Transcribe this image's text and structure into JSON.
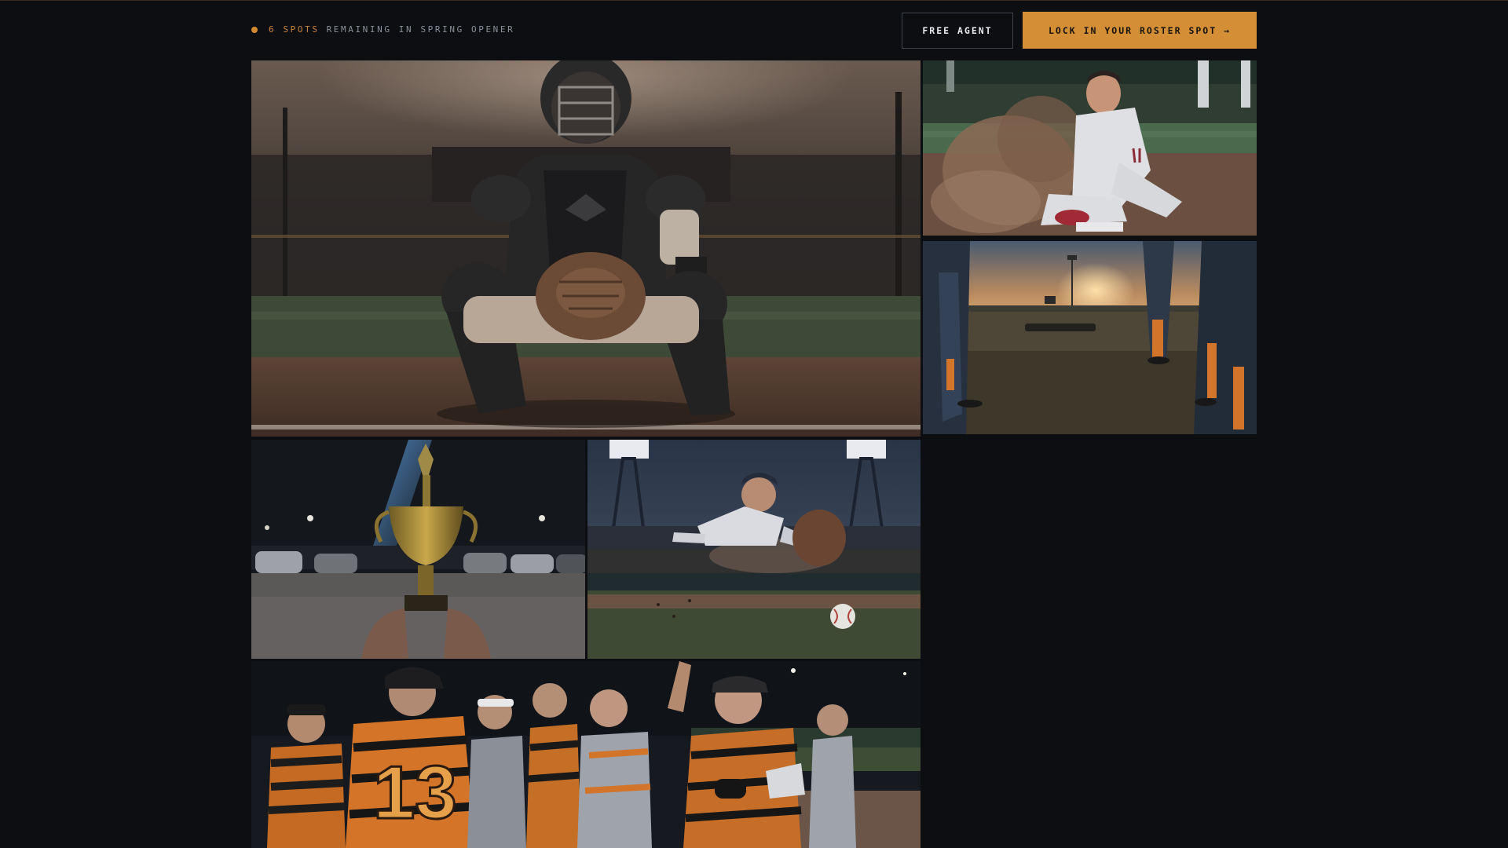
{
  "header": {
    "spots_count": "6 SPOTS",
    "spots_text": "REMAINING IN SPRING OPENER",
    "free_agent_label": "FREE AGENT",
    "cta_label": "LOCK IN YOUR ROSTER SPOT →"
  },
  "colors": {
    "background": "#0c0e12",
    "accent": "#d48f36",
    "muted_text": "#8a8f99"
  },
  "gallery": {
    "tiles": [
      {
        "name": "catcher-crouching-photo"
      },
      {
        "name": "player-sliding-into-base-photo"
      },
      {
        "name": "team-huddle-at-sunset-photo"
      },
      {
        "name": "trophy-in-parking-lot-photo"
      },
      {
        "name": "fielder-diving-for-ball-photo"
      },
      {
        "name": "team-celebrating-photo"
      }
    ],
    "jersey_number": "13"
  }
}
